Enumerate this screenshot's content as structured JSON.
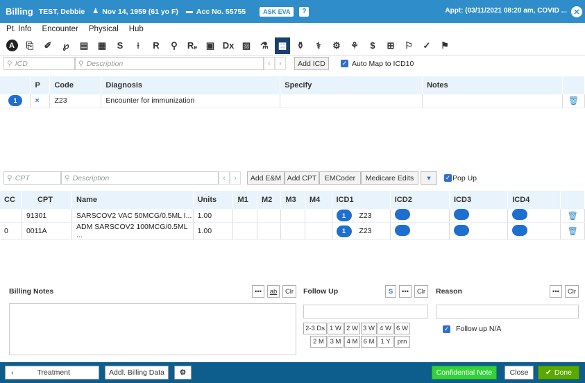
{
  "titlebar": {
    "app": "Billing",
    "patient": "TEST, Debbie",
    "dob": "Nov 14, 1959 (61 yo F)",
    "acc": "Acc No. 55755",
    "ask_eva": "ASK EVA",
    "help": "?",
    "appt": "Appt: (03/11/2021 08:20 am, COVID ...",
    "close": "✕"
  },
  "menu": [
    "Pt. Info",
    "Encounter",
    "Physical",
    "Hub"
  ],
  "toolbar_icons": [
    "A",
    "⎘",
    "✐",
    "℘",
    "▤",
    "▦",
    "S",
    "⟊",
    "R",
    "⚲",
    "Rₑ",
    "▣",
    "Dx",
    "▨",
    "⚗",
    "▦",
    "⚱",
    "⚕",
    "⚙",
    "⚘",
    "$",
    "⊞",
    "⚐",
    "✓",
    "⚑"
  ],
  "icd": {
    "search_placeholder": "ICD",
    "desc_placeholder": "Description",
    "add_label": "Add ICD",
    "auto_map": "Auto Map to ICD10",
    "headers": [
      "P",
      "Code",
      "Diagnosis",
      "Specify",
      "Notes"
    ],
    "rows": [
      {
        "num": "1",
        "p": "×",
        "code": "Z23",
        "diagnosis": "Encounter for immunization",
        "specify": "",
        "notes": ""
      }
    ]
  },
  "cpt": {
    "search_placeholder": "CPT",
    "desc_placeholder": "Description",
    "buttons": [
      "Add E&M",
      "Add CPT",
      "EMCoder",
      "Medicare Edits"
    ],
    "popup": "Pop Up",
    "headers": [
      "CC",
      "CPT",
      "Name",
      "Units",
      "M1",
      "M2",
      "M3",
      "M4",
      "ICD1",
      "ICD2",
      "ICD3",
      "ICD4"
    ],
    "rows": [
      {
        "cc": "",
        "cpt": "91301",
        "name": "SARSCOV2 VAC 50MCG/0.5ML I...",
        "units": "1.00",
        "icd1_num": "1",
        "icd1_code": "Z23"
      },
      {
        "cc": "0",
        "cpt": "0011A",
        "name": "ADM SARSCOV2 100MCG/0.5ML ...",
        "units": "1.00",
        "icd1_num": "1",
        "icd1_code": "Z23"
      }
    ]
  },
  "billing_notes": {
    "title": "Billing Notes",
    "dots": "•••",
    "ab": "ab",
    "clr": "Clr"
  },
  "follow_up": {
    "title": "Follow Up",
    "s": "S",
    "dots": "•••",
    "clr": "Clr",
    "row1": [
      "2-3 Ds",
      "1 W",
      "2 W",
      "3 W",
      "4 W",
      "6 W"
    ],
    "row2": [
      "2 M",
      "3 M",
      "4 M",
      "6 M",
      "1 Y",
      "prn"
    ]
  },
  "reason": {
    "title": "Reason",
    "dots": "•••",
    "clr": "Clr",
    "na_label": "Follow up N/A"
  },
  "footer": {
    "back": "‹",
    "treatment": "Treatment",
    "addl": "Addl. Billing Data",
    "settings": "⚙",
    "confidential": "Confidential Note",
    "close": "Close",
    "done": "Done"
  }
}
